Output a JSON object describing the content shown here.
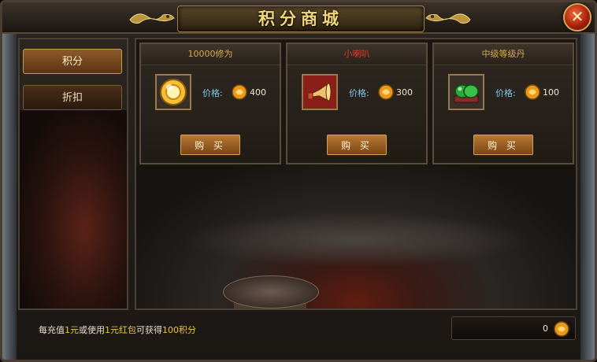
{
  "window": {
    "title": "积分商城",
    "close_label": "✕"
  },
  "tabs": [
    {
      "label": "积分",
      "active": true
    },
    {
      "label": "折扣",
      "active": false
    }
  ],
  "products": [
    {
      "name": "10000修为",
      "price_label": "价格:",
      "price": "400",
      "buy_label": "购 买",
      "icon": "gold-orb-icon",
      "name_color": "#d6a850"
    },
    {
      "name": "小喇叭",
      "price_label": "价格:",
      "price": "300",
      "buy_label": "购 买",
      "icon": "horn-icon",
      "name_color": "#e03a2a"
    },
    {
      "name": "中级等级丹",
      "price_label": "价格:",
      "price": "100",
      "buy_label": "购 买",
      "icon": "green-pill-icon",
      "name_color": "#d6a850"
    }
  ],
  "footer": {
    "info_parts": [
      "每充值",
      "1元",
      "或使用",
      "1元红包",
      "可获得",
      "100积分"
    ],
    "points": "0"
  },
  "colors": {
    "accent_gold": "#f3d77a",
    "price_label": "#7fc8e8",
    "highlight": "#f0c23a"
  }
}
